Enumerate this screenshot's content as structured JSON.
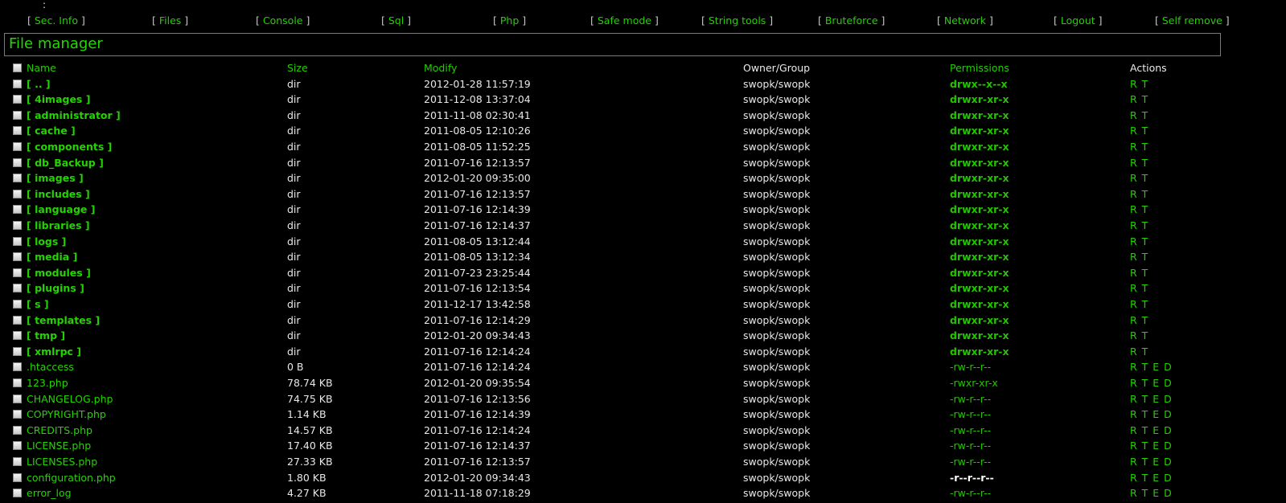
{
  "top_marker": ":",
  "menu": [
    {
      "label": "Sec. Info"
    },
    {
      "label": "Files"
    },
    {
      "label": "Console"
    },
    {
      "label": "Sql"
    },
    {
      "label": "Php"
    },
    {
      "label": "Safe mode"
    },
    {
      "label": "String tools"
    },
    {
      "label": "Bruteforce"
    },
    {
      "label": "Network"
    },
    {
      "label": "Logout"
    },
    {
      "label": "Self remove"
    }
  ],
  "header": {
    "title": "File manager"
  },
  "columns": {
    "name": "Name",
    "size": "Size",
    "modify": "Modify",
    "owner": "Owner/Group",
    "permissions": "Permissions",
    "actions": "Actions"
  },
  "rows": [
    {
      "name": "[ .. ]",
      "size": "dir",
      "modify": "2012-01-28 11:57:19",
      "owner": "swopk/swopk",
      "perms": "drwx--x--x",
      "actions": "R T",
      "type": "dir"
    },
    {
      "name": "[ 4images ]",
      "size": "dir",
      "modify": "2011-12-08 13:37:04",
      "owner": "swopk/swopk",
      "perms": "drwxr-xr-x",
      "actions": "R T",
      "type": "dir"
    },
    {
      "name": "[ administrator ]",
      "size": "dir",
      "modify": "2011-11-08 02:30:41",
      "owner": "swopk/swopk",
      "perms": "drwxr-xr-x",
      "actions": "R T",
      "type": "dir"
    },
    {
      "name": "[ cache ]",
      "size": "dir",
      "modify": "2011-08-05 12:10:26",
      "owner": "swopk/swopk",
      "perms": "drwxr-xr-x",
      "actions": "R T",
      "type": "dir"
    },
    {
      "name": "[ components ]",
      "size": "dir",
      "modify": "2011-08-05 11:52:25",
      "owner": "swopk/swopk",
      "perms": "drwxr-xr-x",
      "actions": "R T",
      "type": "dir"
    },
    {
      "name": "[ db_Backup ]",
      "size": "dir",
      "modify": "2011-07-16 12:13:57",
      "owner": "swopk/swopk",
      "perms": "drwxr-xr-x",
      "actions": "R T",
      "type": "dir"
    },
    {
      "name": "[ images ]",
      "size": "dir",
      "modify": "2012-01-20 09:35:00",
      "owner": "swopk/swopk",
      "perms": "drwxr-xr-x",
      "actions": "R T",
      "type": "dir"
    },
    {
      "name": "[ includes ]",
      "size": "dir",
      "modify": "2011-07-16 12:13:57",
      "owner": "swopk/swopk",
      "perms": "drwxr-xr-x",
      "actions": "R T",
      "type": "dir"
    },
    {
      "name": "[ language ]",
      "size": "dir",
      "modify": "2011-07-16 12:14:39",
      "owner": "swopk/swopk",
      "perms": "drwxr-xr-x",
      "actions": "R T",
      "type": "dir"
    },
    {
      "name": "[ libraries ]",
      "size": "dir",
      "modify": "2011-07-16 12:14:37",
      "owner": "swopk/swopk",
      "perms": "drwxr-xr-x",
      "actions": "R T",
      "type": "dir"
    },
    {
      "name": "[ logs ]",
      "size": "dir",
      "modify": "2011-08-05 13:12:44",
      "owner": "swopk/swopk",
      "perms": "drwxr-xr-x",
      "actions": "R T",
      "type": "dir"
    },
    {
      "name": "[ media ]",
      "size": "dir",
      "modify": "2011-08-05 13:12:34",
      "owner": "swopk/swopk",
      "perms": "drwxr-xr-x",
      "actions": "R T",
      "type": "dir"
    },
    {
      "name": "[ modules ]",
      "size": "dir",
      "modify": "2011-07-23 23:25:44",
      "owner": "swopk/swopk",
      "perms": "drwxr-xr-x",
      "actions": "R T",
      "type": "dir"
    },
    {
      "name": "[ plugins ]",
      "size": "dir",
      "modify": "2011-07-16 12:13:54",
      "owner": "swopk/swopk",
      "perms": "drwxr-xr-x",
      "actions": "R T",
      "type": "dir"
    },
    {
      "name": "[ s ]",
      "size": "dir",
      "modify": "2011-12-17 13:42:58",
      "owner": "swopk/swopk",
      "perms": "drwxr-xr-x",
      "actions": "R T",
      "type": "dir"
    },
    {
      "name": "[ templates ]",
      "size": "dir",
      "modify": "2011-07-16 12:14:29",
      "owner": "swopk/swopk",
      "perms": "drwxr-xr-x",
      "actions": "R T",
      "type": "dir"
    },
    {
      "name": "[ tmp ]",
      "size": "dir",
      "modify": "2012-01-20 09:34:43",
      "owner": "swopk/swopk",
      "perms": "drwxr-xr-x",
      "actions": "R T",
      "type": "dir"
    },
    {
      "name": "[ xmlrpc ]",
      "size": "dir",
      "modify": "2011-07-16 12:14:24",
      "owner": "swopk/swopk",
      "perms": "drwxr-xr-x",
      "actions": "R T",
      "type": "dir"
    },
    {
      "name": ".htaccess",
      "size": "0 B",
      "modify": "2011-07-16 12:14:24",
      "owner": "swopk/swopk",
      "perms": "-rw-r--r--",
      "actions": "R T E D",
      "type": "file"
    },
    {
      "name": "123.php",
      "size": "78.74 KB",
      "modify": "2012-01-20 09:35:54",
      "owner": "swopk/swopk",
      "perms": "-rwxr-xr-x",
      "actions": "R T E D",
      "type": "file"
    },
    {
      "name": "CHANGELOG.php",
      "size": "74.75 KB",
      "modify": "2011-07-16 12:13:56",
      "owner": "swopk/swopk",
      "perms": "-rw-r--r--",
      "actions": "R T E D",
      "type": "file"
    },
    {
      "name": "COPYRIGHT.php",
      "size": "1.14 KB",
      "modify": "2011-07-16 12:14:39",
      "owner": "swopk/swopk",
      "perms": "-rw-r--r--",
      "actions": "R T E D",
      "type": "file"
    },
    {
      "name": "CREDITS.php",
      "size": "14.57 KB",
      "modify": "2011-07-16 12:14:24",
      "owner": "swopk/swopk",
      "perms": "-rw-r--r--",
      "actions": "R T E D",
      "type": "file"
    },
    {
      "name": "LICENSE.php",
      "size": "17.40 KB",
      "modify": "2011-07-16 12:14:37",
      "owner": "swopk/swopk",
      "perms": "-rw-r--r--",
      "actions": "R T E D",
      "type": "file"
    },
    {
      "name": "LICENSES.php",
      "size": "27.33 KB",
      "modify": "2011-07-16 12:13:57",
      "owner": "swopk/swopk",
      "perms": "-rw-r--r--",
      "actions": "R T E D",
      "type": "file"
    },
    {
      "name": "configuration.php",
      "size": "1.80 KB",
      "modify": "2012-01-20 09:34:43",
      "owner": "swopk/swopk",
      "perms": "-r--r--r--",
      "actions": "R T E D",
      "type": "file",
      "perm_style": "white"
    },
    {
      "name": "error_log",
      "size": "4.27 KB",
      "modify": "2011-11-18 07:18:29",
      "owner": "swopk/swopk",
      "perms": "-rw-r--r--",
      "actions": "R T E D",
      "type": "file"
    }
  ],
  "colors": {
    "background": "#000000",
    "accent_green": "#24d400",
    "text_white": "#e8e8e8",
    "bracket_grey": "#c8c8c8"
  }
}
